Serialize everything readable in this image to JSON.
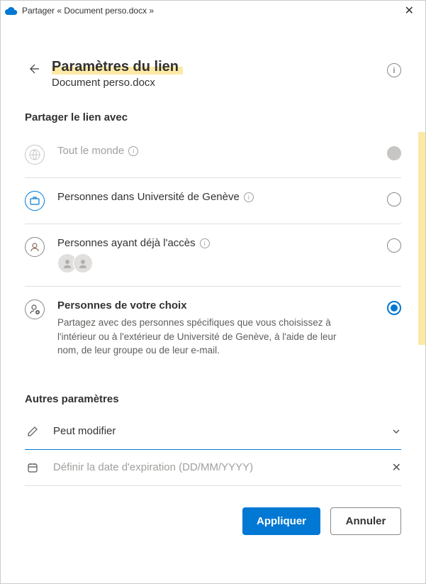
{
  "titlebar": {
    "title": "Partager « Document perso.docx »"
  },
  "header": {
    "title": "Paramètres du lien",
    "subtitle": "Document perso.docx"
  },
  "share_section_title": "Partager le lien avec",
  "options": {
    "anyone": {
      "label": "Tout le monde"
    },
    "org": {
      "label": "Personnes dans Université de Genève"
    },
    "existing": {
      "label": "Personnes ayant déjà l'accès"
    },
    "specific": {
      "label": "Personnes de votre choix",
      "description": "Partagez avec des personnes spécifiques que vous choisissez à l'intérieur ou à l'extérieur de Université de Genève, à l'aide de leur nom, de leur groupe ou de leur e-mail."
    }
  },
  "other_settings_title": "Autres paramètres",
  "edit_permission": {
    "label": "Peut modifier"
  },
  "expiration": {
    "placeholder": "Définir la date d'expiration (DD/MM/YYYY)"
  },
  "buttons": {
    "apply": "Appliquer",
    "cancel": "Annuler"
  }
}
